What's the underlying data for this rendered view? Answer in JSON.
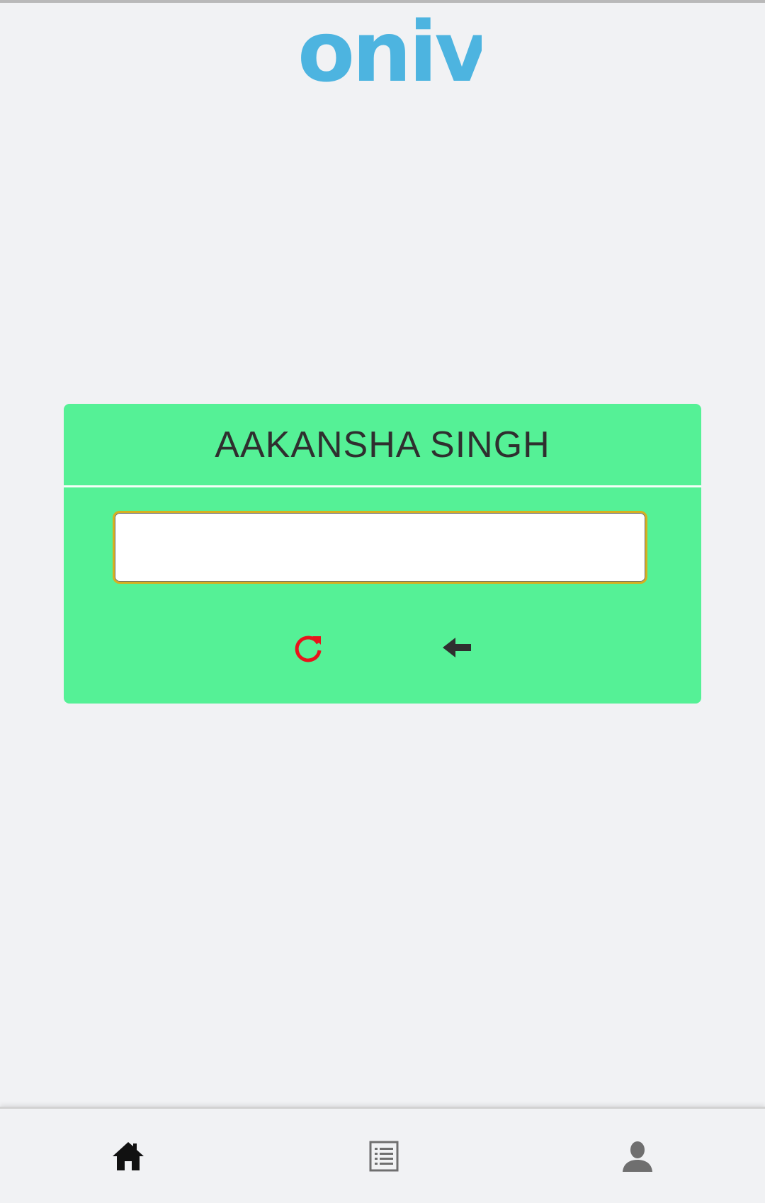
{
  "app": {
    "logo_text": "oniv",
    "brand_color": "#4db4e0"
  },
  "card": {
    "title": "AAKANSHA SINGH",
    "background": "#55f196",
    "input": {
      "value": "",
      "placeholder": ""
    },
    "actions": {
      "refresh_icon": "refresh-icon",
      "refresh_color": "#e8141c",
      "back_icon": "arrow-left-icon",
      "back_color": "#2f2f2f"
    }
  },
  "bottom_nav": {
    "items": [
      {
        "icon": "home-icon",
        "active": true
      },
      {
        "icon": "list-icon",
        "active": false
      },
      {
        "icon": "user-icon",
        "active": false
      }
    ]
  }
}
